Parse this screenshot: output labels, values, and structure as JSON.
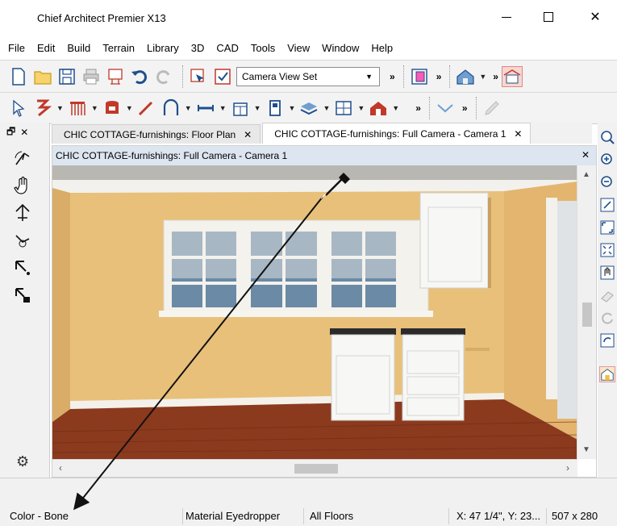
{
  "window": {
    "title": "Chief Architect Premier X13",
    "min_glyph": "—",
    "close_glyph": "✕"
  },
  "menu": {
    "items": [
      "File",
      "Edit",
      "Build",
      "Terrain",
      "Library",
      "3D",
      "CAD",
      "Tools",
      "View",
      "Window",
      "Help"
    ]
  },
  "toolbar": {
    "camera_select": "Camera View Set",
    "overflow_glyph": "»"
  },
  "left_panel": {
    "pin_glyph": "🗗",
    "close_glyph": "✕"
  },
  "tabs": [
    {
      "label": "CHIC COTTAGE-furnishings: Floor Plan",
      "close": "✕",
      "active": false
    },
    {
      "label": "CHIC COTTAGE-furnishings: Full Camera - Camera 1",
      "close": "✕",
      "active": true
    }
  ],
  "document": {
    "title": "CHIC COTTAGE-furnishings: Full Camera - Camera 1",
    "close": "✕"
  },
  "status": {
    "color": "Color - Bone",
    "tool": "Material Eyedropper",
    "floor": "All Floors",
    "coords": "X: 47 1/4\", Y: 23...",
    "size": "507 x 280"
  },
  "colors": {
    "wall": "#e8c07a",
    "floor_wood": "#8b3a1e",
    "trim": "#f4f1ea",
    "cabinet": "#f7f7f5",
    "title_bar_doc": "#dde5f0"
  }
}
